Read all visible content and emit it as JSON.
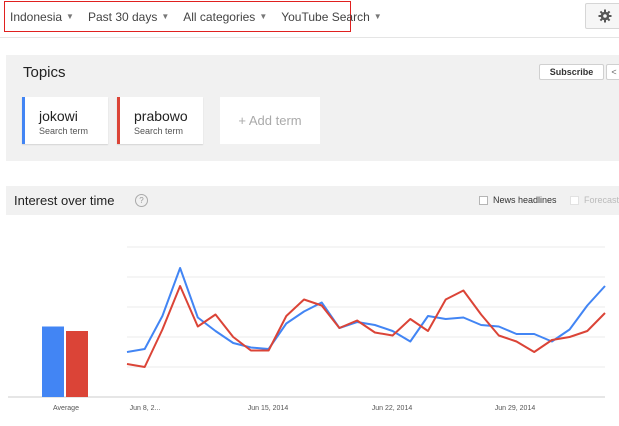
{
  "filters": [
    {
      "label": "Indonesia"
    },
    {
      "label": "Past 30 days"
    },
    {
      "label": "All categories"
    },
    {
      "label": "YouTube Search"
    }
  ],
  "topics": {
    "title": "Topics",
    "subscribe_label": "Subscribe",
    "terms": [
      {
        "name": "jokowi",
        "sub": "Search term",
        "color": "#4285f4"
      },
      {
        "name": "prabowo",
        "sub": "Search term",
        "color": "#db4437"
      }
    ],
    "add_term_label": "+ Add term"
  },
  "interest": {
    "title": "Interest over time",
    "news_headlines_label": "News headlines",
    "forecast_label": "Forecast"
  },
  "chart_data": {
    "type": "line",
    "x_labels": [
      "Jun 8, 2...",
      "Jun 15, 2014",
      "Jun 22, 2014",
      "Jun 29, 2014"
    ],
    "series": [
      {
        "name": "jokowi",
        "color": "#4285f4",
        "values": [
          30,
          32,
          54,
          86,
          53,
          44,
          36,
          33,
          32,
          49,
          57,
          63,
          46,
          50,
          48,
          44,
          37,
          54,
          52,
          53,
          48,
          47,
          42,
          42,
          37,
          45,
          61,
          74
        ]
      },
      {
        "name": "prabowo",
        "color": "#db4437",
        "values": [
          22,
          20,
          45,
          74,
          47,
          55,
          40,
          31,
          31,
          54,
          65,
          61,
          46,
          51,
          43,
          41,
          52,
          44,
          65,
          71,
          55,
          41,
          37,
          30,
          38,
          40,
          44,
          56
        ]
      }
    ],
    "average": {
      "label": "Average",
      "jokowi": 47,
      "prabowo": 44
    },
    "ylim": [
      0,
      100
    ],
    "grid": true
  }
}
